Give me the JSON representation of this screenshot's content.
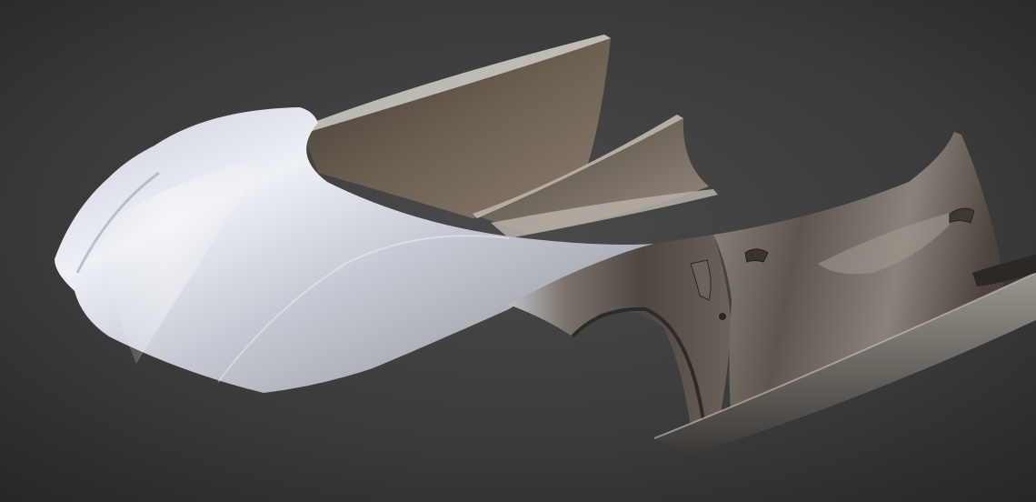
{
  "scene": {
    "subject": "car-body-panels-render",
    "background_color": "#3a3a3a",
    "panel_color_light": "#e8ebf2",
    "panel_color_dark": "#5a5048"
  }
}
